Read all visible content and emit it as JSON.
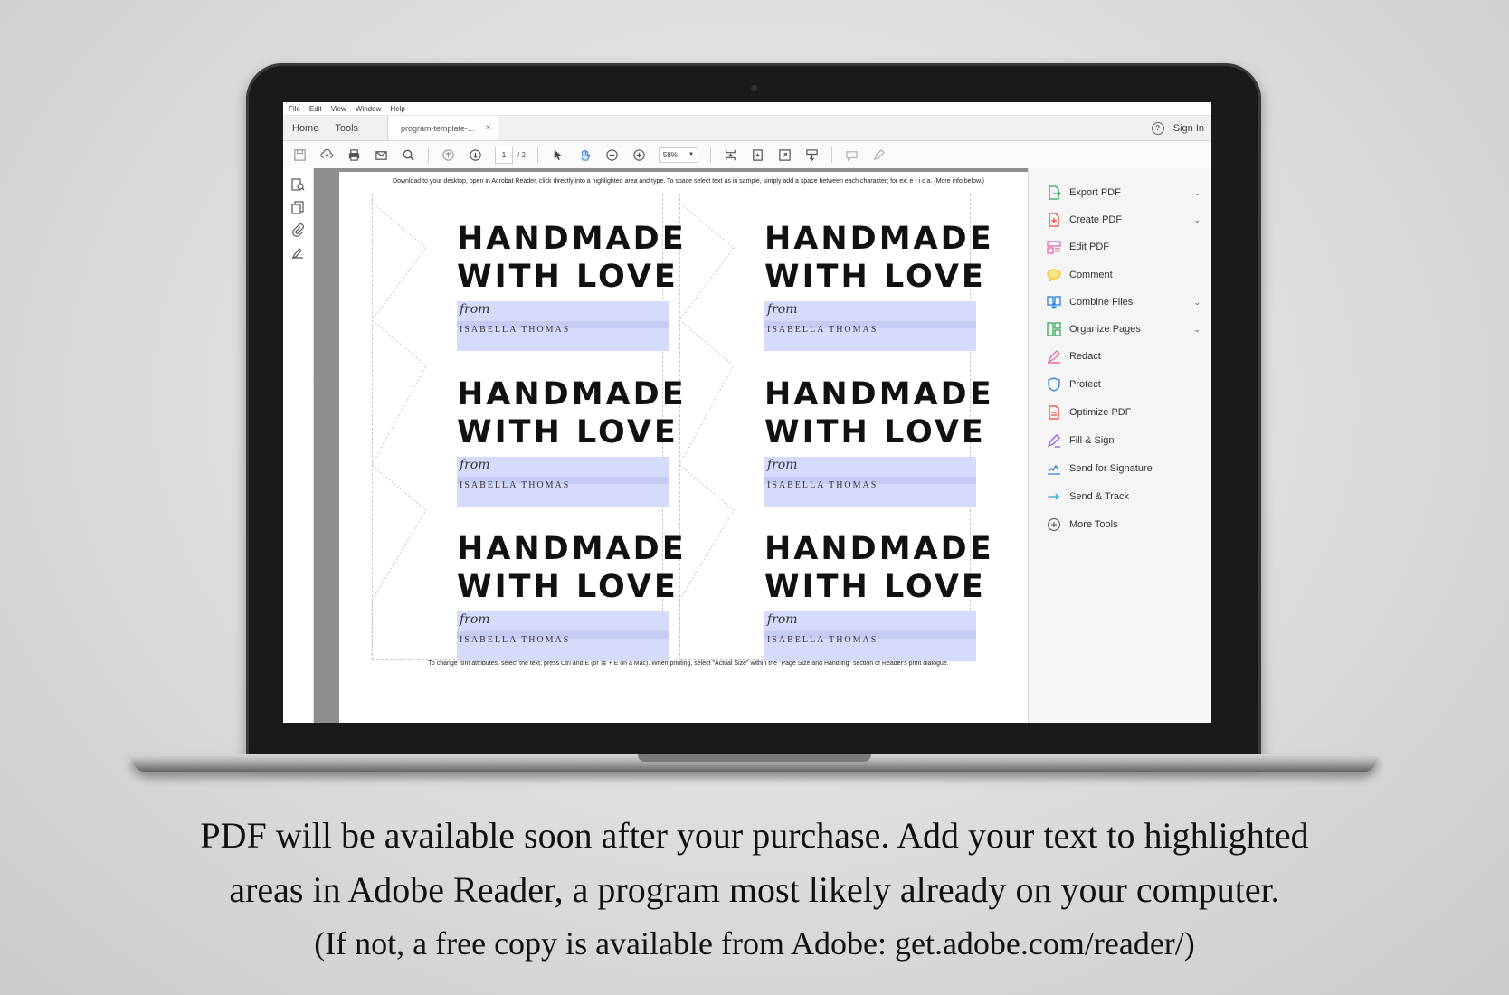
{
  "app": {
    "menu": [
      "File",
      "Edit",
      "View",
      "Window",
      "Help"
    ],
    "nav": {
      "home": "Home",
      "tools": "Tools"
    },
    "document_tab": "program-template-...",
    "tab_close": "×",
    "help": "?",
    "sign_in": "Sign In"
  },
  "toolbar": {
    "page_current": "1",
    "page_total": "/ 2",
    "zoom": "58%"
  },
  "document": {
    "instruction_top": "Download to your desktop, open in Acrobat Reader, click directly into a highlighted area and type. To space select text as in sample, simply add a space between each character; for ex: e r i c a. (More info below.)",
    "instruction_bottom": "To change font attributes, select the text, press Ctrl and E (or ⌘ + E on a Mac).  When printing, select \"Actual Size\" within the \"Page Size and Handling\" section of Reader's print dialogue.",
    "labels": [
      {
        "line1": "HANDMADE",
        "line2": "WITH LOVE",
        "from": "from",
        "name": "ISABELLA THOMAS"
      },
      {
        "line1": "HANDMADE",
        "line2": "WITH LOVE",
        "from": "from",
        "name": "ISABELLA THOMAS"
      },
      {
        "line1": "HANDMADE",
        "line2": "WITH LOVE",
        "from": "from",
        "name": "ISABELLA THOMAS"
      },
      {
        "line1": "HANDMADE",
        "line2": "WITH LOVE",
        "from": "from",
        "name": "ISABELLA THOMAS"
      },
      {
        "line1": "HANDMADE",
        "line2": "WITH LOVE",
        "from": "from",
        "name": "ISABELLA THOMAS"
      },
      {
        "line1": "HANDMADE",
        "line2": "WITH LOVE",
        "from": "from",
        "name": "ISABELLA THOMAS"
      }
    ]
  },
  "tools_panel": [
    {
      "label": "Export PDF",
      "icon": "export-pdf-icon",
      "color": "#3aa55d",
      "chevron": true
    },
    {
      "label": "Create PDF",
      "icon": "create-pdf-icon",
      "color": "#e4463b",
      "chevron": true
    },
    {
      "label": "Edit PDF",
      "icon": "edit-pdf-icon",
      "color": "#e86aa0",
      "chevron": false
    },
    {
      "label": "Comment",
      "icon": "comment-icon",
      "color": "#f0c419",
      "chevron": false
    },
    {
      "label": "Combine Files",
      "icon": "combine-files-icon",
      "color": "#2f7fd6",
      "chevron": true
    },
    {
      "label": "Organize Pages",
      "icon": "organize-pages-icon",
      "color": "#3aa55d",
      "chevron": true
    },
    {
      "label": "Redact",
      "icon": "redact-icon",
      "color": "#e86aa0",
      "chevron": false
    },
    {
      "label": "Protect",
      "icon": "protect-icon",
      "color": "#2f7fd6",
      "chevron": false
    },
    {
      "label": "Optimize PDF",
      "icon": "optimize-pdf-icon",
      "color": "#e4463b",
      "chevron": false
    },
    {
      "label": "Fill & Sign",
      "icon": "fill-sign-icon",
      "color": "#8a5cd6",
      "chevron": false
    },
    {
      "label": "Send for Signature",
      "icon": "send-signature-icon",
      "color": "#2f7fd6",
      "chevron": false
    },
    {
      "label": "Send & Track",
      "icon": "send-track-icon",
      "color": "#2f9fd6",
      "chevron": false
    },
    {
      "label": "More Tools",
      "icon": "more-tools-icon",
      "color": "#666666",
      "chevron": false
    }
  ],
  "caption": {
    "line1": "PDF will be available soon after your purchase.  Add your text to highlighted",
    "line2": "areas in Adobe Reader, a program most likely already on your computer.",
    "line3": "(If not, a free copy is available from Adobe: get.adobe.com/reader/)"
  }
}
